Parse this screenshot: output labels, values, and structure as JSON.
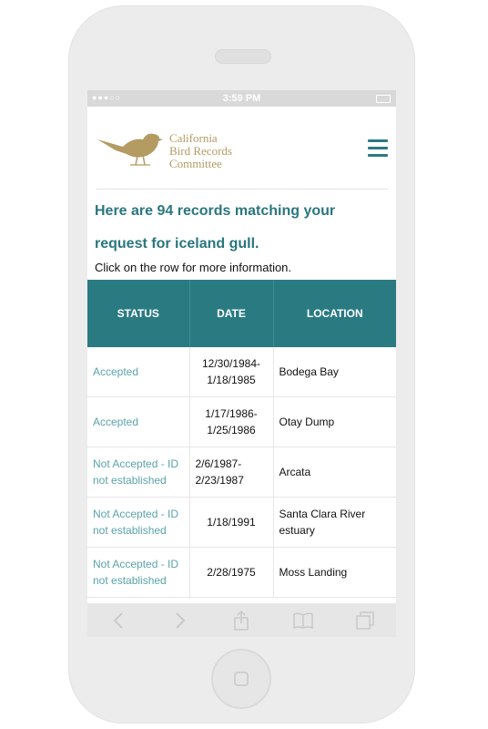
{
  "status_bar": {
    "time": "3:59 PM",
    "signal_dots": "●●●○○"
  },
  "header": {
    "logo_lines": [
      "California",
      "Bird Records",
      "Committee"
    ]
  },
  "result": {
    "title_line1": "Here are 94 records matching your",
    "title_line2": "request for iceland gull.",
    "instruction": "Click on the row for more information."
  },
  "table": {
    "columns": [
      "STATUS",
      "DATE",
      "LOCATION"
    ],
    "rows": [
      {
        "status": "Accepted",
        "date": "12/30/1984-1/18/1985",
        "location": "Bodega Bay"
      },
      {
        "status": "Accepted",
        "date": "1/17/1986-1/25/1986",
        "location": "Otay Dump"
      },
      {
        "status": "Not Accepted - ID not established",
        "date": "2/6/1987-2/23/1987",
        "location": "Arcata"
      },
      {
        "status": "Not Accepted - ID not established",
        "date": "1/18/1991",
        "location": "Santa Clara River estuary"
      },
      {
        "status": "Not Accepted - ID not established",
        "date": "2/28/1975",
        "location": "Moss Landing"
      }
    ]
  },
  "toolbar_icons": [
    "back-arrow-icon",
    "forward-arrow-icon",
    "share-icon",
    "bookmarks-icon",
    "tabs-icon"
  ],
  "colors": {
    "accent": "#2a7a82",
    "link": "#5aa3aa",
    "logo": "#b39b62"
  }
}
